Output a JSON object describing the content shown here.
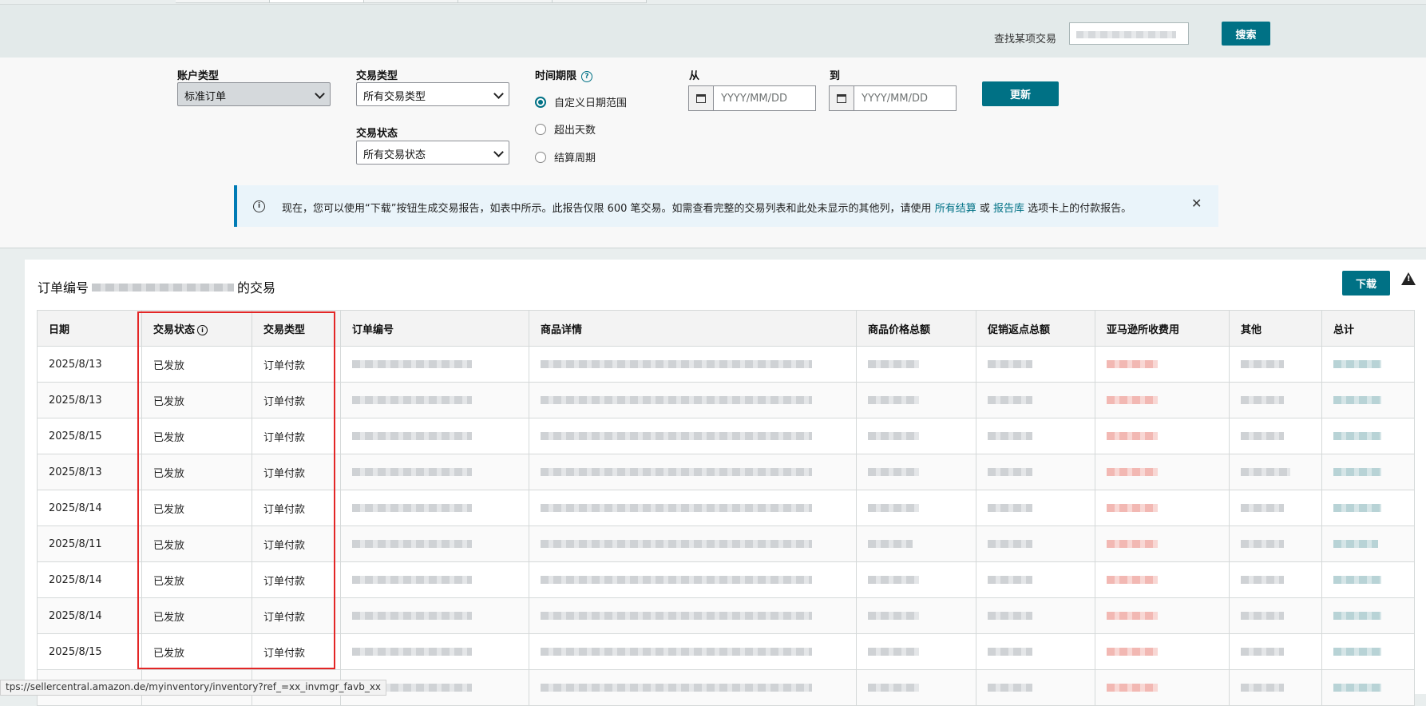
{
  "search": {
    "label": "查找某项交易",
    "button": "搜索"
  },
  "filters": {
    "account_type": {
      "label": "账户类型",
      "value": "标准订单"
    },
    "transaction_type": {
      "label": "交易类型",
      "value": "所有交易类型"
    },
    "transaction_status": {
      "label": "交易状态",
      "value": "所有交易状态"
    },
    "period": {
      "label": "时间期限",
      "options": [
        "自定义日期范围",
        "超出天数",
        "结算周期"
      ],
      "selected": "自定义日期范围"
    },
    "from": {
      "label": "从",
      "placeholder": "YYYY/MM/DD"
    },
    "to": {
      "label": "到",
      "placeholder": "YYYY/MM/DD"
    },
    "update_button": "更新"
  },
  "alert": {
    "text_before": "现在，您可以使用“下载”按钮生成交易报告，如表中所示。此报告仅限 600 笔交易。如需查看完整的交易列表和此处未显示的其他列，请使用 ",
    "link1": "所有结算",
    "middle": " 或 ",
    "link2": "报告库",
    "text_after": " 选项卡上的付款报告。"
  },
  "panel": {
    "title_prefix": "订单编号",
    "title_suffix": "的交易",
    "download_button": "下载"
  },
  "table": {
    "headers": [
      "日期",
      "交易状态",
      "交易类型",
      "订单编号",
      "商品详情",
      "商品价格总额",
      "促销返点总额",
      "亚马逊所收费用",
      "其他",
      "总计"
    ],
    "rows": [
      {
        "date": "2025/8/13",
        "status": "已发放",
        "type": "订单付款"
      },
      {
        "date": "2025/8/13",
        "status": "已发放",
        "type": "订单付款"
      },
      {
        "date": "2025/8/15",
        "status": "已发放",
        "type": "订单付款"
      },
      {
        "date": "2025/8/13",
        "status": "已发放",
        "type": "订单付款"
      },
      {
        "date": "2025/8/14",
        "status": "已发放",
        "type": "订单付款"
      },
      {
        "date": "2025/8/11",
        "status": "已发放",
        "type": "订单付款"
      },
      {
        "date": "2025/8/14",
        "status": "已发放",
        "type": "订单付款"
      },
      {
        "date": "2025/8/14",
        "status": "已发放",
        "type": "订单付款"
      },
      {
        "date": "2025/8/15",
        "status": "已发放",
        "type": "订单付款"
      },
      {
        "date": "",
        "status": "",
        "type": ""
      }
    ]
  },
  "status_bar": {
    "url": "tps://sellercentral.amazon.de/myinventory/inventory?ref_=xx_invmgr_favb_xx"
  },
  "colors": {
    "accent": "#007185",
    "highlight": "#e32626"
  }
}
